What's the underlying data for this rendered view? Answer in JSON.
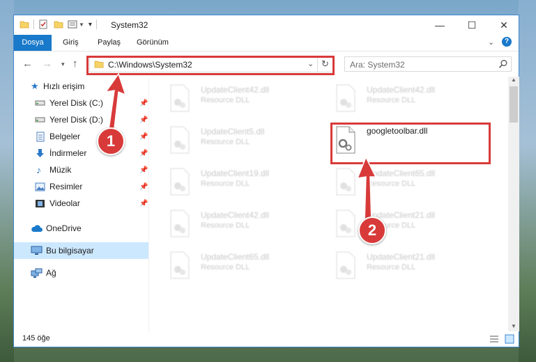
{
  "window": {
    "title": "System32",
    "minimize": "—",
    "maximize": "☐",
    "close": "✕"
  },
  "ribbon": {
    "tabs": [
      "Dosya",
      "Giriş",
      "Paylaş",
      "Görünüm"
    ]
  },
  "address": {
    "path": "C:\\Windows\\System32"
  },
  "search": {
    "placeholder": "Ara: System32"
  },
  "sidebar": {
    "items": [
      {
        "label": "Hızlı erişim",
        "icon": "star-icon"
      },
      {
        "label": "Yerel Disk (C:)",
        "icon": "drive-icon"
      },
      {
        "label": "Yerel Disk (D:)",
        "icon": "drive-icon"
      },
      {
        "label": "Belgeler",
        "icon": "documents-icon"
      },
      {
        "label": "İndirmeler",
        "icon": "download-icon"
      },
      {
        "label": "Müzik",
        "icon": "music-icon"
      },
      {
        "label": "Resimler",
        "icon": "pictures-icon"
      },
      {
        "label": "Videolar",
        "icon": "videos-icon"
      },
      {
        "label": "OneDrive",
        "icon": "cloud-icon"
      },
      {
        "label": "Bu bilgisayar",
        "icon": "computer-icon"
      },
      {
        "label": "Ağ",
        "icon": "network-icon"
      }
    ]
  },
  "files": [
    {
      "name": "UpdateClient42.dll",
      "type": "Resource DLL"
    },
    {
      "name": "UpdateClient42.dll",
      "type": "Resource DLL"
    },
    {
      "name": "UpdateClient5.dll",
      "type": "Resource DLL"
    },
    {
      "name": "googletoolbar.dll",
      "type": ""
    },
    {
      "name": "UpdateClient19.dll",
      "type": "Resource DLL"
    },
    {
      "name": "UpdateClient65.dll",
      "type": "Resource DLL"
    },
    {
      "name": "UpdateClient42.dll",
      "type": "Resource DLL"
    },
    {
      "name": "UpdateClient21.dll",
      "type": "Resource DLL"
    },
    {
      "name": "UpdateClient65.dll",
      "type": "Resource DLL"
    },
    {
      "name": "UpdateClient21.dll",
      "type": "Resource DLL"
    }
  ],
  "status": {
    "count": "145 öğe"
  },
  "annotations": {
    "step1": "1",
    "step2": "2"
  },
  "colors": {
    "accent": "#1979ca",
    "highlight": "#d83a3a",
    "selection": "#cce8ff"
  }
}
